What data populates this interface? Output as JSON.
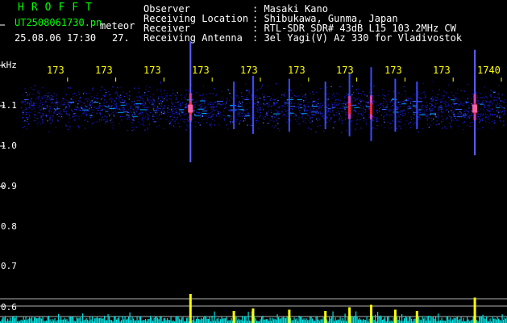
{
  "header": {
    "app_title": "HROFFT",
    "filename": "UT2508061730.pn",
    "mode": "meteor",
    "datetime": "25.08.06 17:30",
    "count": "27.",
    "info": [
      {
        "label": "Observer",
        "value": ": Masaki Kano"
      },
      {
        "label": "Receiving Location",
        "value": ": Shibukawa, Gunma, Japan"
      },
      {
        "label": "Receiver",
        "value": ": RTL-SDR SDR# 43dB L15 103.2MHz CW"
      },
      {
        "label": "Receiving Antenna",
        "value": ": 3el Yagi(V) Az 330 for Vladivostok"
      }
    ]
  },
  "axis": {
    "unit_label": "kHz",
    "y_ticks": [
      "1.1",
      "1.0",
      "0.9",
      "0.8",
      "0.7",
      "0.6"
    ],
    "x_ticks": [
      "173",
      "173",
      "173",
      "173",
      "173",
      "173",
      "173",
      "173",
      "173",
      "1740"
    ]
  },
  "colors": {
    "background": "#000000",
    "header_green": "#00ff00",
    "tick_yellow": "#ffff00",
    "noise_blue": "#1a1aff",
    "meteor_red": "#ff2040",
    "histogram_cyan": "#00e0e0",
    "histogram_peak": "#ffff00"
  },
  "meteor_events": [
    {
      "minute": 3.55,
      "strength": 1.0
    },
    {
      "minute": 4.45,
      "strength": 0.3
    },
    {
      "minute": 4.85,
      "strength": 0.4
    },
    {
      "minute": 5.6,
      "strength": 0.35
    },
    {
      "minute": 6.35,
      "strength": 0.3
    },
    {
      "minute": 6.85,
      "strength": 0.45
    },
    {
      "minute": 7.3,
      "strength": 0.55
    },
    {
      "minute": 7.8,
      "strength": 0.35
    },
    {
      "minute": 8.25,
      "strength": 0.3
    },
    {
      "minute": 9.45,
      "strength": 0.85
    },
    {
      "minute": 10.25,
      "strength": 0.3
    },
    {
      "minute": 10.85,
      "strength": 0.35
    },
    {
      "minute": 11.3,
      "strength": 0.35
    },
    {
      "minute": 11.85,
      "strength": 0.3
    },
    {
      "minute": 12.3,
      "strength": 0.3
    },
    {
      "minute": 12.75,
      "strength": 0.45
    },
    {
      "minute": 13.1,
      "strength": 0.6
    },
    {
      "minute": 13.55,
      "strength": 0.7
    }
  ]
}
